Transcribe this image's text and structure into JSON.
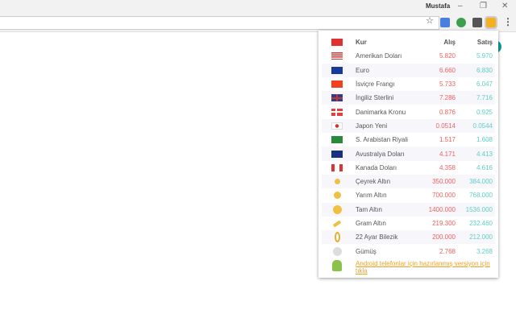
{
  "window": {
    "user": "Mustafa",
    "minimize": "–",
    "restore": "❐",
    "close": "✕"
  },
  "toolbar": {
    "star": "☆",
    "menu": "⋮"
  },
  "table": {
    "headers": {
      "kur": "Kur",
      "alis": "Alış",
      "satis": "Satış"
    },
    "rows": [
      {
        "name": "Amerikan Doları",
        "buy": "5.820",
        "sell": "5.970",
        "icon": "us-flag"
      },
      {
        "name": "Euro",
        "buy": "6.660",
        "sell": "6.830",
        "icon": "eu-flag"
      },
      {
        "name": "İsviçre Frangı",
        "buy": "5.733",
        "sell": "6.047",
        "icon": "ch-flag"
      },
      {
        "name": "İngiliz Sterlini",
        "buy": "7.286",
        "sell": "7.716",
        "icon": "gb-flag"
      },
      {
        "name": "Danimarka Kronu",
        "buy": "0.876",
        "sell": "0.925",
        "icon": "dk-flag"
      },
      {
        "name": "Japon Yeni",
        "buy": "0.0514",
        "sell": "0.0544",
        "icon": "jp-flag"
      },
      {
        "name": "S. Arabistan Riyali",
        "buy": "1.517",
        "sell": "1.608",
        "icon": "sa-flag"
      },
      {
        "name": "Avustralya Doları",
        "buy": "4.171",
        "sell": "4.413",
        "icon": "au-flag"
      },
      {
        "name": "Kanada Doları",
        "buy": "4.358",
        "sell": "4.616",
        "icon": "ca-flag"
      },
      {
        "name": "Çeyrek Altın",
        "buy": "350.000",
        "sell": "384.000",
        "icon": "small-coin"
      },
      {
        "name": "Yarım Altın",
        "buy": "700.000",
        "sell": "768.000",
        "icon": "medium-coin"
      },
      {
        "name": "Tam Altın",
        "buy": "1400.000",
        "sell": "1536.000",
        "icon": "large-coin"
      },
      {
        "name": "Gram Altın",
        "buy": "219.300",
        "sell": "232.460",
        "icon": "gold-bar"
      },
      {
        "name": "22 Ayar Bilezik",
        "buy": "200.000",
        "sell": "212.000",
        "icon": "bracelet"
      },
      {
        "name": "Gümüş",
        "buy": "2.768",
        "sell": "3.268",
        "icon": "silver-coin"
      }
    ],
    "android_link": "Android telefonlar için hazırlanmış versiyon için tıkla"
  }
}
